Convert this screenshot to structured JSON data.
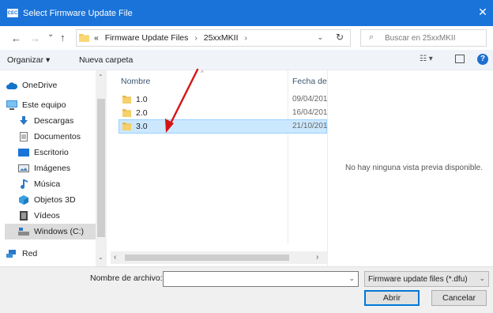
{
  "window": {
    "title": "Select Firmware Update File",
    "app_icon_text": "CEC",
    "close_glyph": "✕"
  },
  "nav": {
    "back_glyph": "←",
    "forward_glyph": "→",
    "recent_glyph": "⌄",
    "up_glyph": "↑",
    "breadcrumb_prefix": "«",
    "breadcrumb": [
      "Firmware Update Files",
      "25xxMKII"
    ],
    "breadcrumb_sep": "›",
    "dropdown_glyph": "⌄",
    "refresh_glyph": "↻",
    "search_placeholder": "Buscar en 25xxMKII",
    "search_icon_glyph": "⌕"
  },
  "toolbar": {
    "organize_label": "Organizar ▾",
    "new_folder_label": "Nueva carpeta",
    "view_label": "☷ ▾",
    "help_label": "?"
  },
  "sidebar": {
    "items": [
      {
        "label": "OneDrive",
        "icon": "cloud-icon"
      },
      {
        "label": "Este equipo",
        "icon": "computer-icon"
      },
      {
        "label": "Descargas",
        "icon": "download-icon"
      },
      {
        "label": "Documentos",
        "icon": "documents-icon"
      },
      {
        "label": "Escritorio",
        "icon": "desktop-icon"
      },
      {
        "label": "Imágenes",
        "icon": "pictures-icon"
      },
      {
        "label": "Música",
        "icon": "music-icon"
      },
      {
        "label": "Objetos 3D",
        "icon": "objects-3d-icon"
      },
      {
        "label": "Vídeos",
        "icon": "videos-icon"
      },
      {
        "label": "Windows (C:)",
        "icon": "drive-icon"
      },
      {
        "label": "Red",
        "icon": "network-icon"
      }
    ],
    "selected_index": 9,
    "scroll_up_glyph": "⌃",
    "scroll_down_glyph": "⌄"
  },
  "files": {
    "columns": {
      "name": "Nombre",
      "date": "Fecha de"
    },
    "sort_glyph": "^",
    "rows": [
      {
        "name": "1.0",
        "date": "09/04/201"
      },
      {
        "name": "2.0",
        "date": "16/04/201"
      },
      {
        "name": "3.0",
        "date": "21/10/201"
      }
    ],
    "selected_index": 2,
    "scroll_left_glyph": "‹",
    "scroll_right_glyph": "›"
  },
  "preview": {
    "message": "No hay ninguna vista previa disponible."
  },
  "bottom": {
    "filename_label": "Nombre de archivo:",
    "filename_value": "",
    "filter_value": "Firmware update files (*.dfu)",
    "dropdown_glyph": "⌄",
    "open_label": "Abrir",
    "cancel_label": "Cancelar"
  },
  "colors": {
    "titlebar": "#1a73d8",
    "selection": "#cce8ff",
    "folder": "#f3c95a",
    "annotation_arrow": "#d41414"
  }
}
